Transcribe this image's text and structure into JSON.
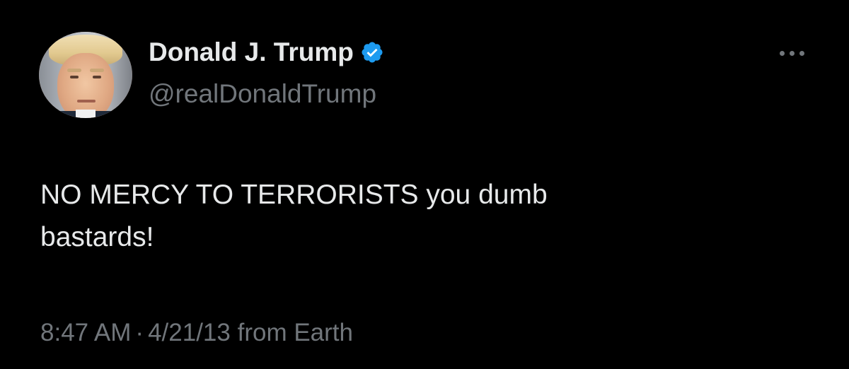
{
  "tweet": {
    "author": {
      "display_name": "Donald J. Trump",
      "handle": "@realDonaldTrump",
      "verified": true,
      "verified_icon": "verified-badge-icon",
      "avatar": "profile-photo"
    },
    "more_icon": "more-options-icon",
    "text_line1": "NO MERCY TO TERRORISTS you dumb",
    "text_line2": "bastards!",
    "time": "8:47 AM",
    "separator": "·",
    "date": "4/21/13",
    "source": "from Earth"
  },
  "colors": {
    "background": "#000000",
    "primary_text": "#e7e9ea",
    "secondary_text": "#71767b",
    "verified_blue": "#1d9bf0"
  }
}
